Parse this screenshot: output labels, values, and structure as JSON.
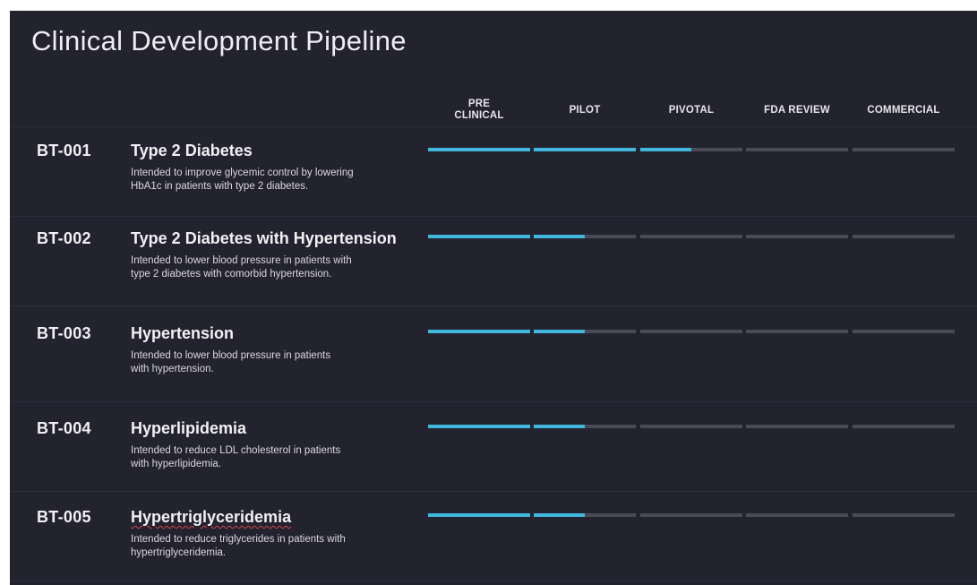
{
  "title": "Clinical Development Pipeline",
  "stages": [
    {
      "line1": "PRE",
      "line2": "CLINICAL"
    },
    {
      "line1": "PILOT",
      "line2": ""
    },
    {
      "line1": "PIVOTAL",
      "line2": ""
    },
    {
      "line1": "FDA REVIEW",
      "line2": ""
    },
    {
      "line1": "COMMERCIAL",
      "line2": ""
    }
  ],
  "colors": {
    "background": "#23222f",
    "progress_fill": "#3fb8dc",
    "progress_track": "#4a4a55"
  },
  "programs": [
    {
      "code": "BT-001",
      "name": "Type 2 Diabetes",
      "desc_line1": "Intended to improve glycemic control by lowering",
      "desc_line2": "HbA1c in patients with type 2 diabetes.",
      "stage_progress": [
        1,
        1,
        0.5,
        0,
        0
      ]
    },
    {
      "code": "BT-002",
      "name": "Type 2 Diabetes with Hypertension",
      "desc_line1": "Intended to lower blood pressure in patients with",
      "desc_line2": "type 2 diabetes with comorbid hypertension.",
      "stage_progress": [
        1,
        0.5,
        0,
        0,
        0
      ]
    },
    {
      "code": "BT-003",
      "name": "Hypertension",
      "desc_line1": "Intended to lower blood pressure in patients",
      "desc_line2": "with hypertension.",
      "stage_progress": [
        1,
        0.5,
        0,
        0,
        0
      ]
    },
    {
      "code": "BT-004",
      "name": "Hyperlipidemia",
      "desc_line1": "Intended to reduce LDL cholesterol in patients",
      "desc_line2": "with hyperlipidemia.",
      "stage_progress": [
        1,
        0.5,
        0,
        0,
        0
      ]
    },
    {
      "code": "BT-005",
      "name": "Hypertriglyceridemia",
      "desc_line1": "Intended to reduce triglycerides in patients with",
      "desc_line2": "hypertriglyceridemia.",
      "stage_progress": [
        1,
        0.5,
        0,
        0,
        0
      ]
    }
  ]
}
